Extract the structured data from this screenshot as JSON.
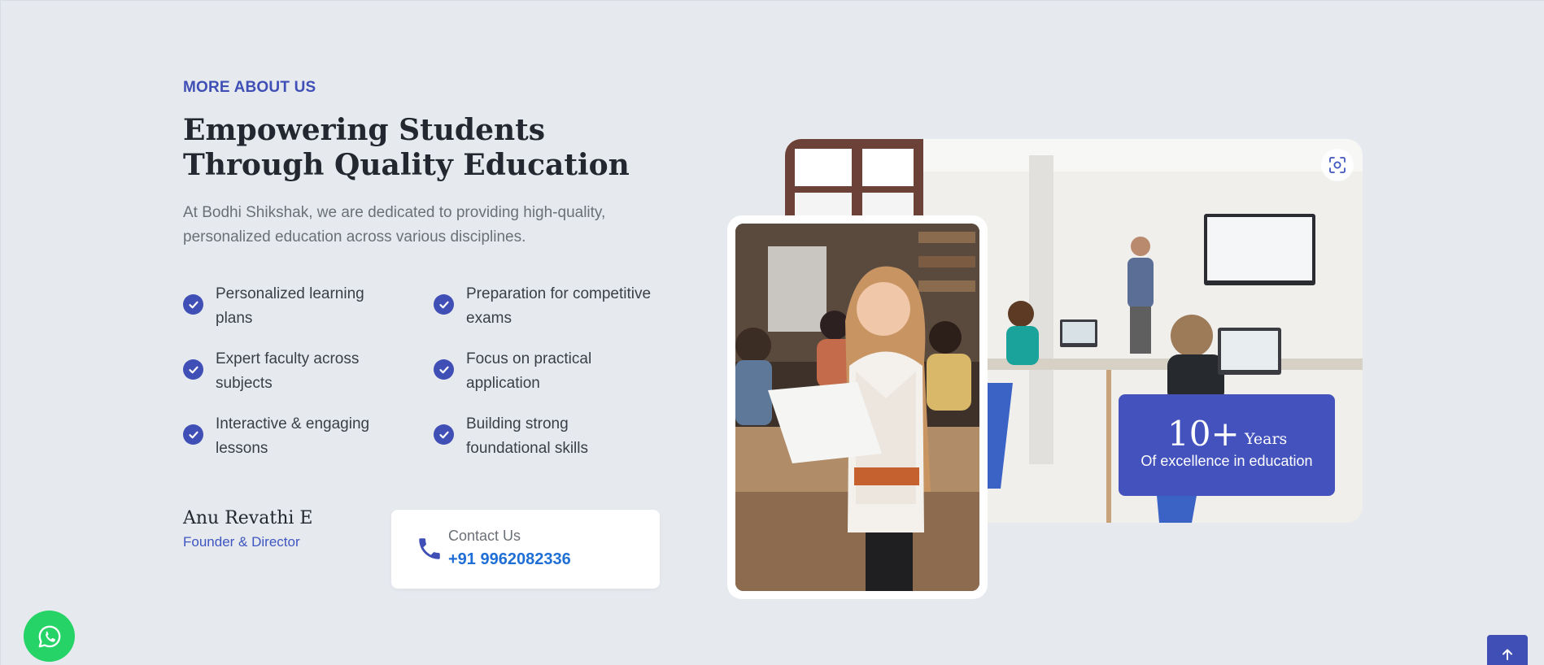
{
  "about": {
    "eyebrow": "MORE ABOUT US",
    "title": "Empowering Students Through Quality Education",
    "description": "At Bodhi Shikshak, we are dedicated to providing high-quality, personalized education across various disciplines."
  },
  "features": [
    "Personalized learning plans",
    "Preparation for competitive exams",
    "Expert faculty across subjects",
    "Focus on practical application",
    "Interactive & engaging lessons",
    "Building strong foundational skills"
  ],
  "founder": {
    "name": "Anu Revathi E",
    "role": "Founder & Director"
  },
  "contact": {
    "label": "Contact Us",
    "phone": "+91 9962082336"
  },
  "stats": {
    "number": "10+",
    "unit": "Years",
    "caption": "Of excellence in education"
  },
  "icons": {
    "check": "check-circle-icon",
    "phone": "phone-icon",
    "zoom": "zoom-icon",
    "whatsapp": "whatsapp-icon",
    "scroll_top": "arrow-up-icon"
  },
  "colors": {
    "brand": "#3f4fb5",
    "link": "#1f6fd6",
    "whatsapp": "#25d366",
    "background": "#e6eaef"
  }
}
